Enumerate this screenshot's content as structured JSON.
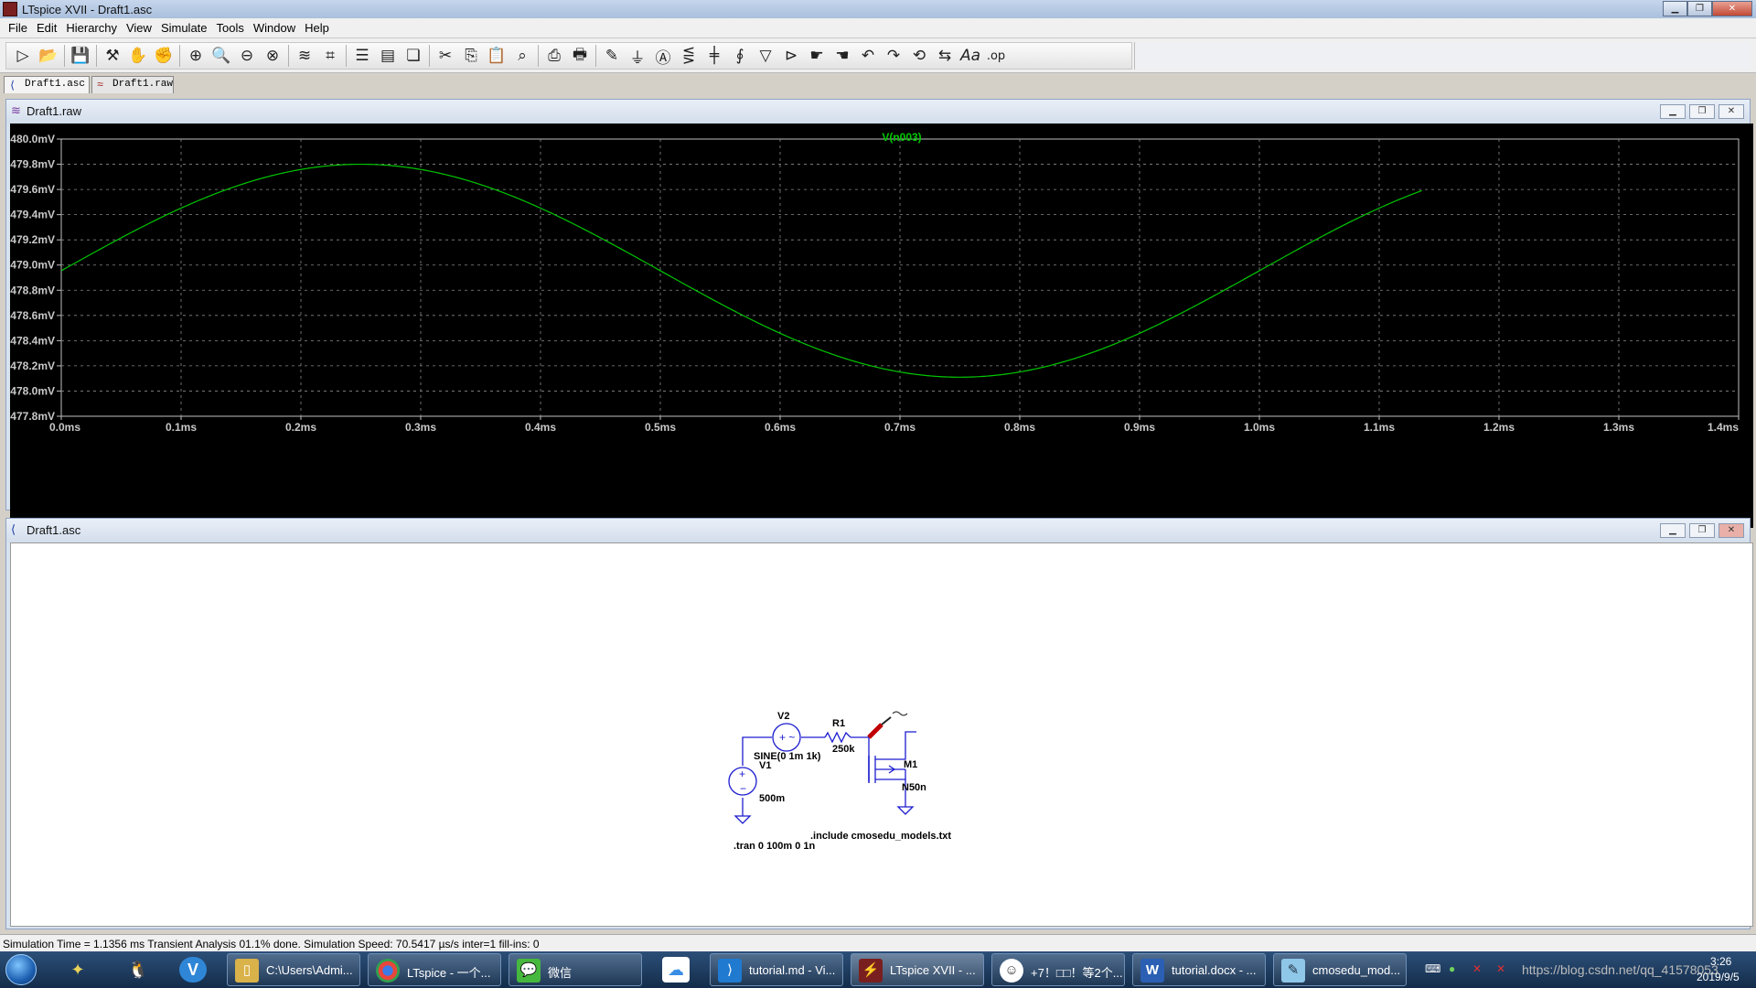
{
  "window": {
    "title": "LTspice XVII - Draft1.asc"
  },
  "menu": [
    "File",
    "Edit",
    "Hierarchy",
    "View",
    "Simulate",
    "Tools",
    "Window",
    "Help"
  ],
  "toolbar_icons": [
    "run",
    "open",
    "save",
    "control-panel",
    "halt",
    "pan",
    "zoom-in",
    "zoom-area",
    "zoom-out",
    "zoom-fit",
    "autorange-y",
    "delete-trace",
    "tile-horizontal",
    "tile-vertical",
    "cascade",
    "cut",
    "copy",
    "paste",
    "find",
    "print-preview",
    "print",
    "wire",
    "ground",
    "label-net",
    "resistor",
    "capacitor",
    "inductor",
    "diode",
    "component",
    "move",
    "drag",
    "undo",
    "redo",
    "rotate",
    "mirror",
    "text",
    "spice-directive"
  ],
  "tabs": [
    {
      "label": "Draft1.asc",
      "icon": "schematic-icon"
    },
    {
      "label": "Draft1.raw",
      "icon": "waveform-icon"
    }
  ],
  "waveform_window": {
    "title": "Draft1.raw"
  },
  "schematic_window": {
    "title": "Draft1.asc"
  },
  "chart_data": {
    "type": "line",
    "trace_label": "V(n003)",
    "trace_color": "#00c800",
    "x_ticks": [
      "0.0ms",
      "0.1ms",
      "0.2ms",
      "0.3ms",
      "0.4ms",
      "0.5ms",
      "0.6ms",
      "0.7ms",
      "0.8ms",
      "0.9ms",
      "1.0ms",
      "1.1ms",
      "1.2ms",
      "1.3ms",
      "1.4ms"
    ],
    "y_ticks": [
      "480.0mV",
      "479.8mV",
      "479.6mV",
      "479.4mV",
      "479.2mV",
      "479.0mV",
      "478.8mV",
      "478.6mV",
      "478.4mV",
      "478.2mV",
      "478.0mV",
      "477.8mV"
    ],
    "xlim": [
      0,
      1.4
    ],
    "ylim": [
      477.8,
      480.0
    ],
    "grid": true,
    "series": [
      {
        "name": "V(n003)",
        "x_start": 0,
        "x_end": 1.1356,
        "offset": 478.955,
        "amplitude": 0.845,
        "freq_khz": 1
      }
    ]
  },
  "schematic": {
    "V2": {
      "name": "V2",
      "value": "SINE(0 1m 1k)"
    },
    "V1": {
      "name": "V1",
      "value": "500m"
    },
    "R1": {
      "name": "R1",
      "value": "250k"
    },
    "M1": {
      "name": "M1",
      "value": "N50n"
    },
    "directives": {
      "tran": ".tran 0 100m 0 1n",
      "include": ".include cmosedu_models.txt"
    }
  },
  "status": "Simulation Time = 1.1356 ms  Transient Analysis 01.1% done. Simulation Speed: 70.5417 µs/s inter=1 fill-ins: 0",
  "taskbar": {
    "buttons": [
      "C:\\Users\\Admi...",
      "LTspice - 一个...",
      "微信",
      "tutorial.md - Vi...",
      "LTspice XVII - ...",
      "+7！□□！等2个...",
      "tutorial.docx - ...",
      "cmosedu_mod..."
    ],
    "clock_time": "3:26",
    "clock_date": "2019/9/5",
    "watermark": "https://blog.csdn.net/qq_41578053"
  }
}
